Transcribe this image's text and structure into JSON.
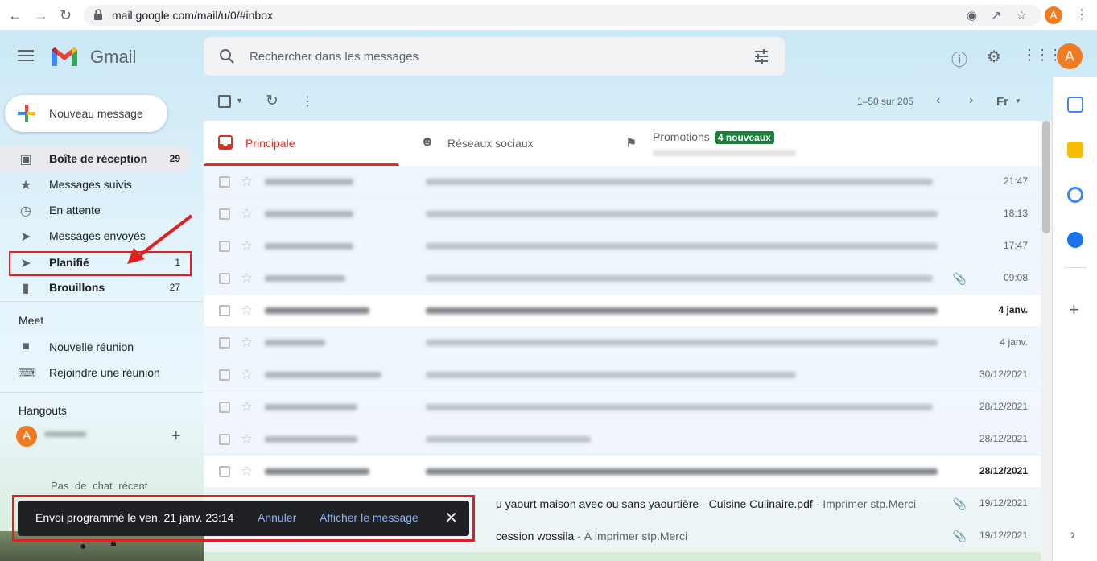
{
  "browser": {
    "url": "mail.google.com/mail/u/0/#inbox",
    "profile_initial": "A"
  },
  "header": {
    "brand": "Gmail",
    "search_placeholder": "Rechercher dans les messages",
    "account_initial": "A"
  },
  "compose": {
    "label": "Nouveau message"
  },
  "sidebar": {
    "items": [
      {
        "label": "Boîte de réception",
        "count": "29",
        "icon": "inbox-icon"
      },
      {
        "label": "Messages suivis",
        "count": "",
        "icon": "star-icon"
      },
      {
        "label": "En attente",
        "count": "",
        "icon": "clock-icon"
      },
      {
        "label": "Messages envoyés",
        "count": "",
        "icon": "send-icon"
      },
      {
        "label": "Planifié",
        "count": "1",
        "icon": "scheduled-send-icon"
      },
      {
        "label": "Brouillons",
        "count": "27",
        "icon": "draft-icon"
      }
    ],
    "meet": {
      "title": "Meet",
      "items": [
        {
          "label": "Nouvelle réunion",
          "icon": "video-icon"
        },
        {
          "label": "Rejoindre une réunion",
          "icon": "keyboard-icon"
        }
      ]
    },
    "hangouts": {
      "title": "Hangouts",
      "user_initial": "A",
      "no_chat": "Pas de chat récent"
    }
  },
  "toolbar": {
    "pagination": "1–50 sur 205",
    "language": "Fr"
  },
  "tabs": [
    {
      "label": "Principale",
      "selected": true
    },
    {
      "label": "Réseaux sociaux",
      "selected": false
    },
    {
      "label": "Promotions",
      "badge": "4 nouveaux",
      "selected": false
    }
  ],
  "emails": [
    {
      "date": "21:47",
      "unread": false,
      "attachment": false
    },
    {
      "date": "18:13",
      "unread": false,
      "attachment": false
    },
    {
      "date": "17:47",
      "unread": false,
      "attachment": false
    },
    {
      "date": "09:08",
      "unread": false,
      "attachment": true
    },
    {
      "date": "4 janv.",
      "unread": true,
      "attachment": false
    },
    {
      "date": "4 janv.",
      "unread": false,
      "attachment": false
    },
    {
      "date": "30/12/2021",
      "unread": false,
      "attachment": false
    },
    {
      "date": "28/12/2021",
      "unread": false,
      "attachment": false
    },
    {
      "date": "28/12/2021",
      "unread": false,
      "attachment": false
    },
    {
      "date": "28/12/2021",
      "unread": true,
      "attachment": false
    },
    {
      "date": "19/12/2021",
      "unread": false,
      "attachment": true,
      "subject": "u yaourt maison avec ou sans yaourtière - Cuisine Culinaire.pdf",
      "snippet": " - Imprimer stp.Merci"
    },
    {
      "date": "19/12/2021",
      "unread": false,
      "attachment": true,
      "subject": "cession wossila",
      "snippet": " - À imprimer stp.Merci"
    }
  ],
  "toast": {
    "message": "Envoi programmé le ven. 21 janv. 23:14",
    "undo": "Annuler",
    "view": "Afficher le message"
  },
  "colors": {
    "accent_red": "#d93025",
    "annotation_red": "#e02020",
    "badge_green": "#188038",
    "avatar_orange": "#f07b23"
  }
}
